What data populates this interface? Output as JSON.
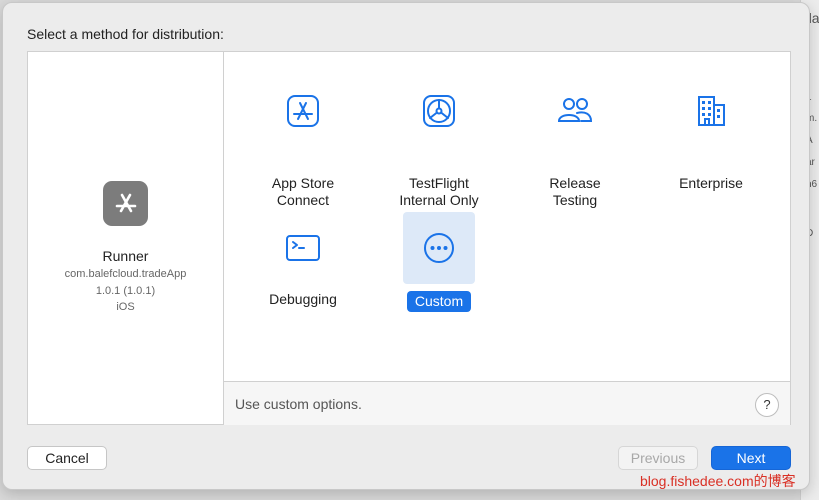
{
  "dialog": {
    "title": "Select a method for distribution:"
  },
  "app": {
    "icon": "app-store-icon",
    "name": "Runner",
    "bundle_id": "com.balefcloud.tradeApp",
    "version": "1.0.1 (1.0.1)",
    "platform": "iOS"
  },
  "options": [
    {
      "label": "App Store\nConnect",
      "icon": "app-store-icon",
      "selected": false
    },
    {
      "label": "TestFlight\nInternal Only",
      "icon": "testflight-icon",
      "selected": false
    },
    {
      "label": "Release\nTesting",
      "icon": "people-icon",
      "selected": false
    },
    {
      "label": "Enterprise",
      "icon": "building-icon",
      "selected": false
    },
    {
      "label": "Debugging",
      "icon": "terminal-icon",
      "selected": false
    },
    {
      "label": "Custom",
      "icon": "ellipsis-icon",
      "selected": true
    }
  ],
  "help": {
    "description": "Use custom options.",
    "button_label": "?"
  },
  "buttons": {
    "cancel": "Cancel",
    "previous": "Previous",
    "next": "Next"
  },
  "background_fragments": [
    "da",
    "1",
    "m.",
    "A",
    "ar",
    "h6",
    "D"
  ],
  "watermark": "blog.fishedee.com的博客",
  "colors": {
    "accent": "#1a73e8",
    "selected_tile": "#dde9f8",
    "app_icon_bg": "#7c7c7c"
  }
}
